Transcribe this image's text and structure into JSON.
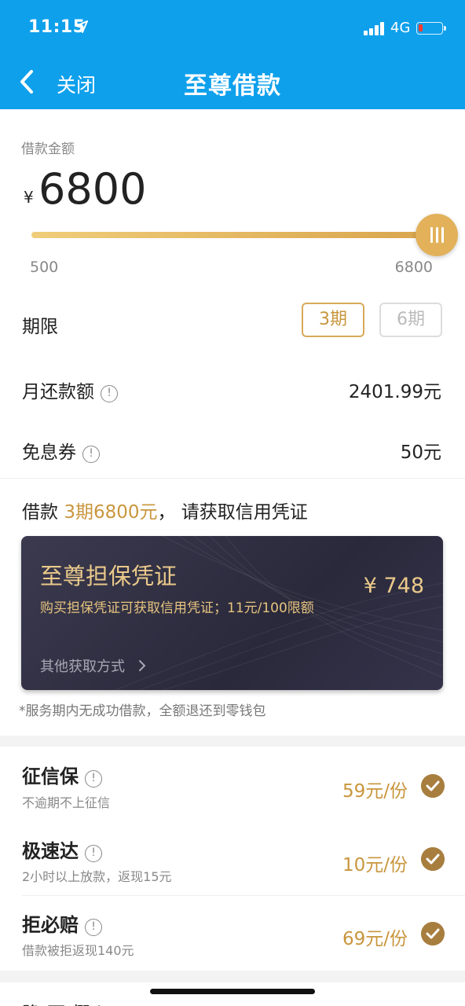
{
  "status_bar": {
    "time": "11:15",
    "network": "4G"
  },
  "nav": {
    "back_label": "关闭",
    "title": "至尊借款"
  },
  "loan": {
    "amount_label": "借款金额",
    "currency_symbol": "¥",
    "amount": "6800",
    "slider_min": "500",
    "slider_max": "6800",
    "slider_fraction": 1.0
  },
  "period": {
    "label": "期限",
    "options": [
      "3期",
      "6期"
    ],
    "selected": "3期"
  },
  "monthly": {
    "label": "月还款额",
    "value": "2401.99元"
  },
  "coupon": {
    "label": "免息券",
    "value": "50元"
  },
  "credit_line": {
    "prefix": "借款 ",
    "highlight": "3期6800元",
    "suffix": "，  请获取信用凭证"
  },
  "voucher": {
    "title": "至尊担保凭证",
    "desc": "购买担保凭证可获取信用凭证；11元/100限额",
    "price": "¥ 748",
    "other": "其他获取方式"
  },
  "refund_note": "*服务期内无成功借款，全额退还到零钱包",
  "services": [
    {
      "title": "征信保",
      "subtitle": "不逾期不上征信",
      "price": "59元/份"
    },
    {
      "title": "极速达",
      "subtitle": "2小时以上放款，返现15元",
      "price": "10元/份"
    },
    {
      "title": "拒必赔",
      "subtitle": "借款被拒返现140元",
      "price": "69元/份"
    }
  ],
  "bottom_partial": "隐 再 假 h",
  "colors": {
    "header": "#0fa0ec",
    "gold": "#c9963d",
    "check": "#a87e3f"
  }
}
